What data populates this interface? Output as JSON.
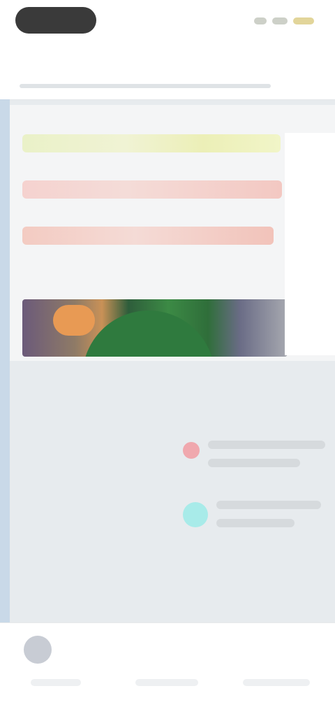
{
  "status_bar": {
    "camera": "camera-pill"
  },
  "header": {
    "title": ""
  },
  "article": {
    "headline_lines": [
      "",
      "",
      ""
    ],
    "image": "hero-image"
  },
  "popups": [
    {
      "icon": "alert-icon",
      "text_lines": [
        "",
        ""
      ]
    },
    {
      "icon": "chat-icon",
      "text_lines": [
        "",
        ""
      ]
    }
  ],
  "bottom_nav": {
    "items": [
      {
        "label": ""
      },
      {
        "label": ""
      },
      {
        "label": ""
      }
    ],
    "avatar": "avatar"
  },
  "colors": {
    "rail": "#c9d9e8",
    "headline_one": "#eef2c6",
    "headline_two": "#f4d2cd",
    "headline_three": "#f2c6bd",
    "popup_red": "#f0a8ae",
    "popup_cyan": "#a8ebe9"
  }
}
